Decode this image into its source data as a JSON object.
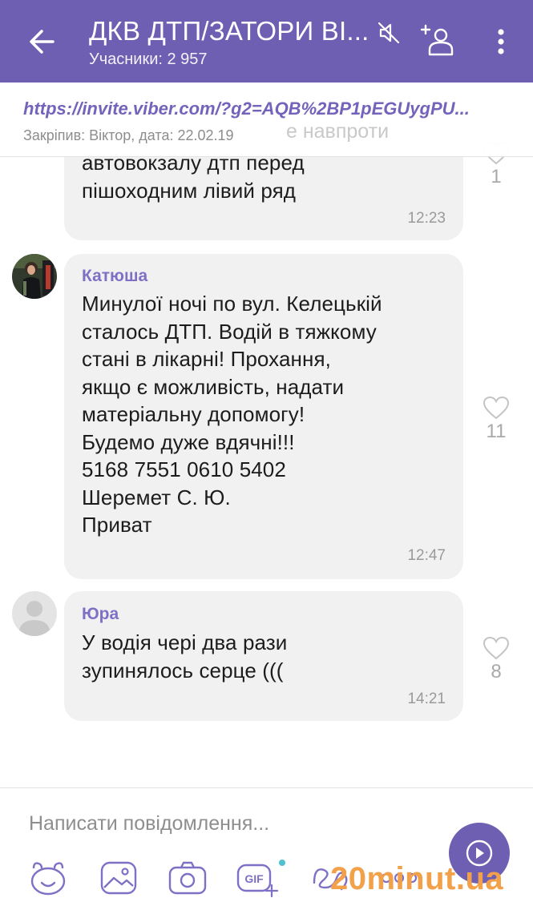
{
  "header": {
    "title": "ДКВ ДТП/ЗАТОРИ ВІ...",
    "subtitle": "Учасники: 2 957"
  },
  "pinned": {
    "link": "https://invite.viber.com/?g2=AQB%2BP1pEGUygPU...",
    "meta": "Закріпив: Віктор, дата: 22.02.19",
    "ghost_text": "е навпроти"
  },
  "messages": [
    {
      "sender": "",
      "text": "автовокзалу дтп перед\nпішоходним лівий ряд",
      "time": "12:23",
      "likes": "1"
    },
    {
      "sender": "Катюша",
      "text": "Минулої ночі по вул. Келецькій\nсталось ДТП. Водій в тяжкому\nстані в лікарні! Прохання,\nякщо є можливість, надати\nматеріальну допомогу!\nБудемо дуже вдячні!!!\n5168 7551 0610 5402\nШеремет С. Ю.\nПриват",
      "time": "12:47",
      "likes": "11"
    },
    {
      "sender": "Юра",
      "text": "У водія чері два рази\nзупинялось серце (((",
      "time": "14:21",
      "likes": "8"
    }
  ],
  "composer": {
    "placeholder": "Написати повідомлення..."
  },
  "watermark": "20minut.ua",
  "colors": {
    "header": "#6f5fb2",
    "sender": "#7f70c5",
    "link": "#7463bb",
    "bubble": "#f1f1f1",
    "watermark": "#f2a14a"
  },
  "icons": [
    "back-arrow-icon",
    "mute-icon",
    "add-participant-icon",
    "more-vert-icon",
    "heart-icon",
    "send-icon",
    "sticker-icon",
    "image-icon",
    "camera-icon",
    "gif-icon",
    "doodle-icon",
    "more-horiz-icon"
  ]
}
